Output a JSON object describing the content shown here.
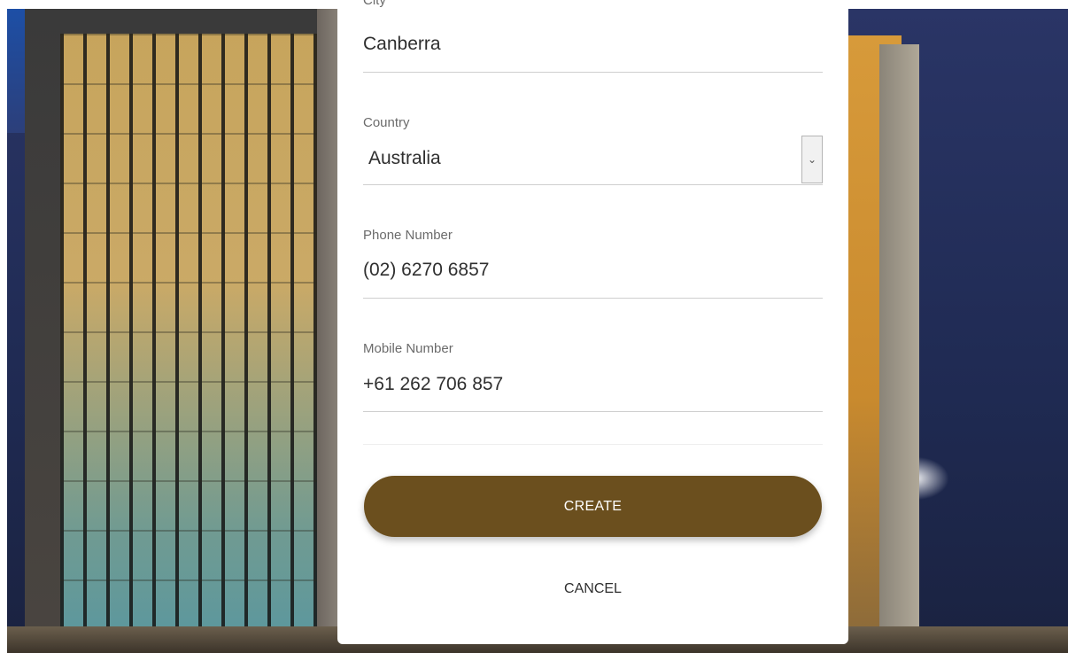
{
  "form": {
    "city": {
      "label": "City",
      "value": "Canberra"
    },
    "country": {
      "label": "Country",
      "value": "Australia",
      "dropdown_icon": "chevron-down-icon"
    },
    "phone": {
      "label": "Phone Number",
      "value": "(02) 6270 6857"
    },
    "mobile": {
      "label": "Mobile Number",
      "value": "+61 262 706 857"
    }
  },
  "actions": {
    "create_label": "CREATE",
    "cancel_label": "CANCEL"
  },
  "colors": {
    "primary_button": "#6b4f1e",
    "panel_background": "#ffffff"
  }
}
